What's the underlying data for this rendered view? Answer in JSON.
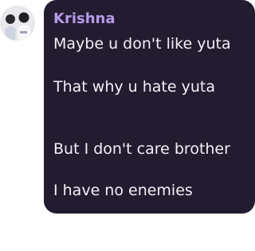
{
  "chat": {
    "avatar_icon": "profile-avatar-icon",
    "sender_name": "Krishna",
    "bubble_color": "#231c31",
    "name_color": "#b59be6",
    "messages": [
      "Maybe u don't like yuta",
      "That why u hate yuta",
      "But I don't care brother",
      "I have no enemies"
    ]
  }
}
